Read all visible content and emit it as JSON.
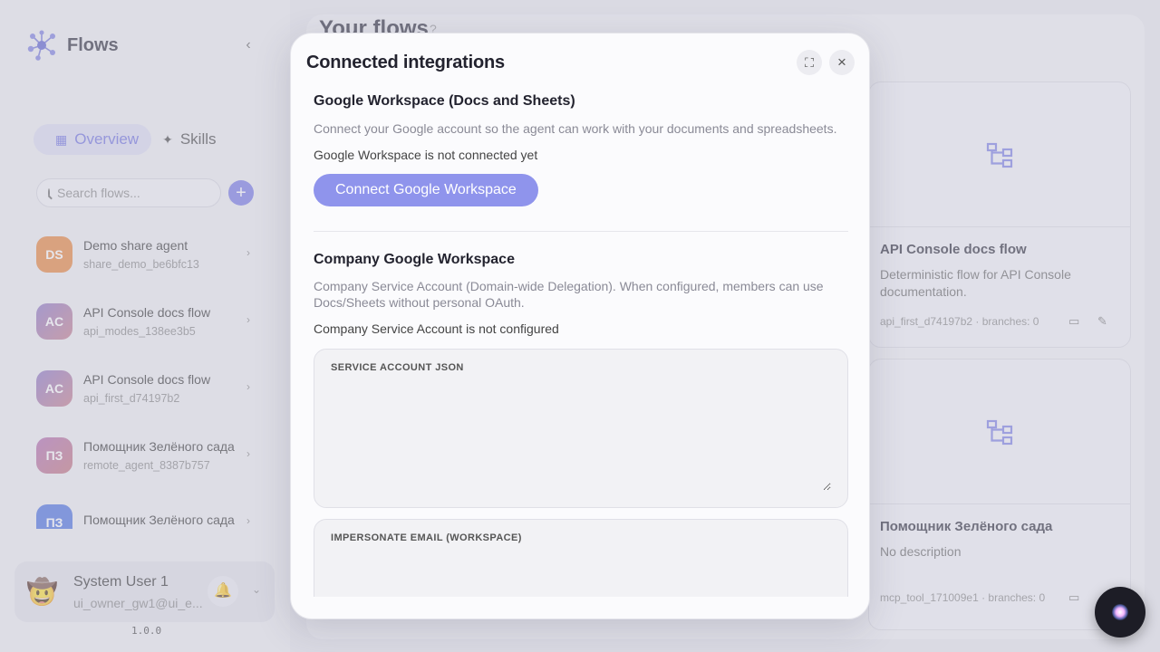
{
  "app": {
    "name": "Flows",
    "version": "1.0.0"
  },
  "sidebar": {
    "tabs": [
      {
        "label": "Overview",
        "icon": "grid-icon",
        "active": true
      },
      {
        "label": "Skills",
        "icon": "sparkles-icon",
        "active": false
      }
    ],
    "search": {
      "placeholder": "Search flows...",
      "help": "?"
    },
    "flows": [
      {
        "initials": "DS",
        "name": "Demo share agent",
        "id": "share_demo_be6bfc13",
        "color": "#e8833a"
      },
      {
        "initials": "AC",
        "name": "API Console docs flow",
        "id": "api_modes_138ee3b5",
        "color": "#8a74c4"
      },
      {
        "initials": "AC",
        "name": "API Console docs flow",
        "id": "api_first_d74197b2",
        "color": "#8a74c4"
      },
      {
        "initials": "ПЗ",
        "name": "Помощник Зелёного сада",
        "id": "remote_agent_8387b757",
        "color": "#b06ab0"
      },
      {
        "initials": "ПЗ",
        "name": "Помощник Зелёного сада",
        "id": "",
        "color": "#4a6fe0"
      }
    ],
    "user": {
      "name": "System User 1",
      "email": "ui_owner_gw1@ui_e..."
    }
  },
  "main": {
    "title": "Your flows",
    "help": "?",
    "cards": [
      {
        "name": "API Console docs flow",
        "description": "Deterministic flow for API Console documentation.",
        "meta": "api_first_d74197b2 · branches: 0"
      },
      {
        "name": "Помощник Зелёного сада",
        "description": "No description",
        "meta": "mcp_tool_171009e1 · branches: 0"
      }
    ]
  },
  "modal": {
    "title": "Connected integrations",
    "google": {
      "title": "Google Workspace (Docs and Sheets)",
      "description": "Connect your Google account so the agent can work with your documents and spreadsheets.",
      "status": "Google Workspace is not connected yet",
      "button": "Connect Google Workspace"
    },
    "company": {
      "title": "Company Google Workspace",
      "description": "Company Service Account (Domain-wide Delegation). When configured, members can use Docs/Sheets without personal OAuth.",
      "status": "Company Service Account is not configured",
      "json_label": "SERVICE ACCOUNT JSON",
      "json_value": "",
      "email_label": "IMPERSONATE EMAIL (WORKSPACE)",
      "email_value": ""
    }
  },
  "colors": {
    "accent": "#7577e6",
    "button": "#8f94ec"
  }
}
